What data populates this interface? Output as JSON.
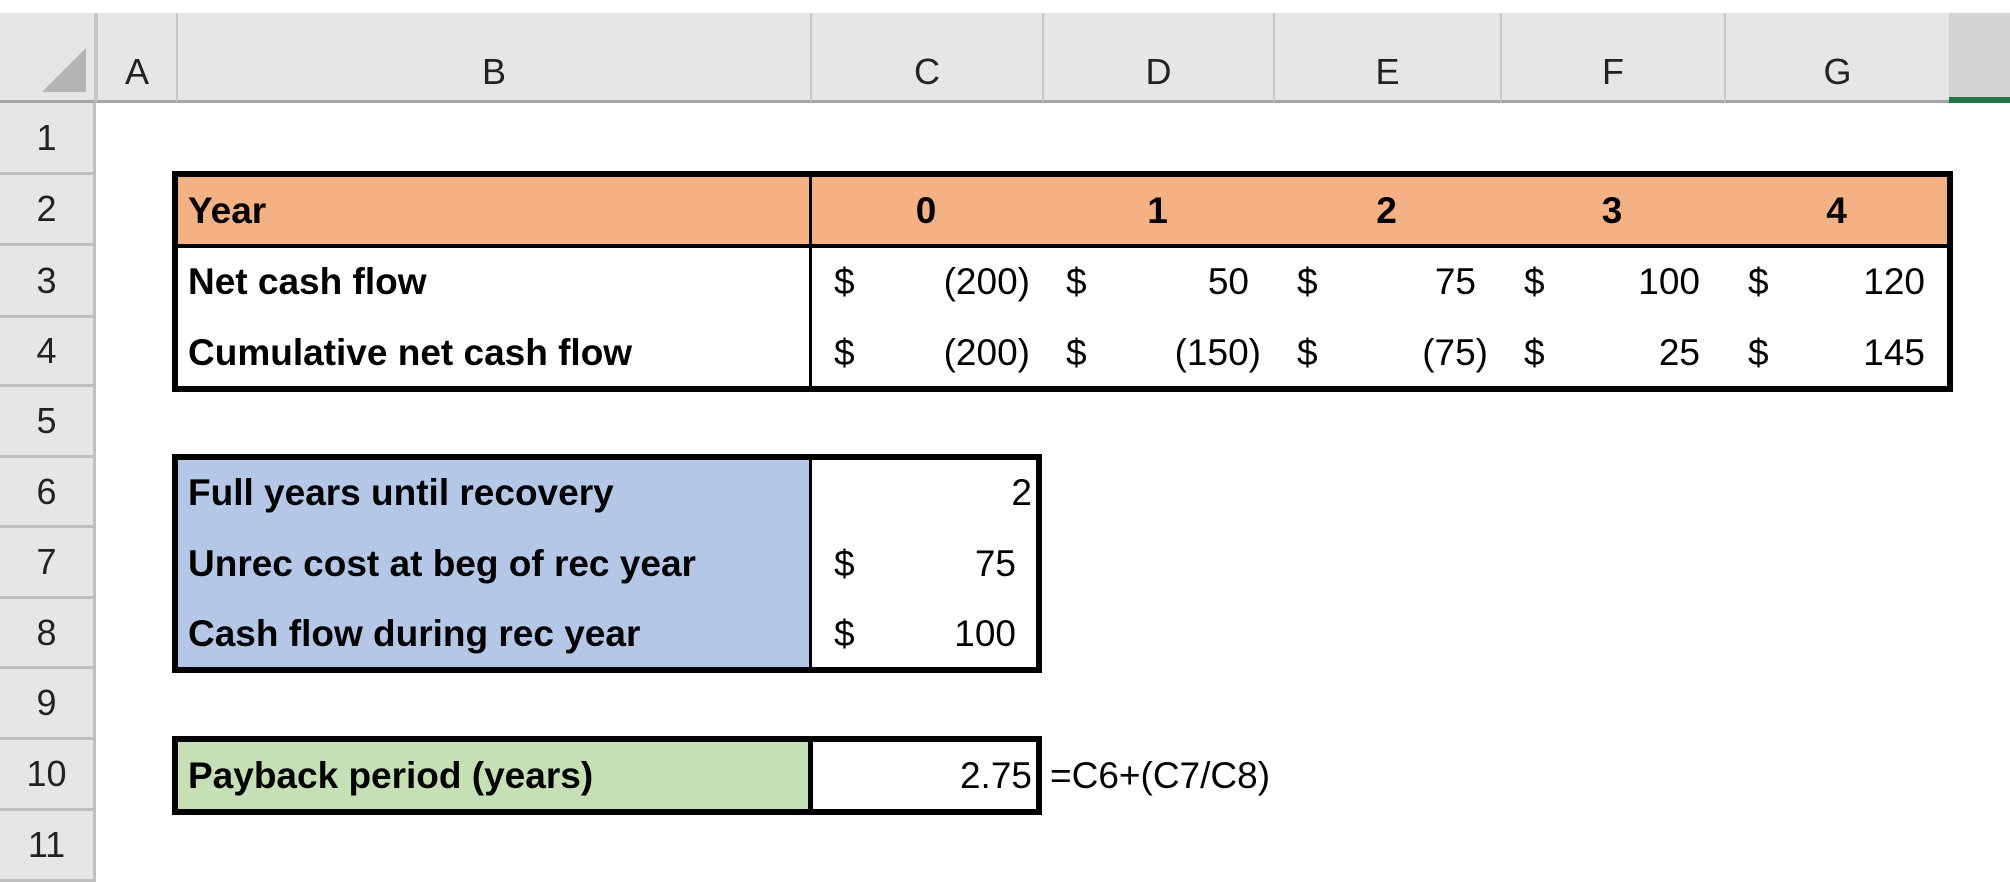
{
  "columns": [
    "A",
    "B",
    "C",
    "D",
    "E",
    "F",
    "G"
  ],
  "rows": [
    "1",
    "2",
    "3",
    "4",
    "5",
    "6",
    "7",
    "8",
    "9",
    "10",
    "11"
  ],
  "colors": {
    "year_header": "#f4b183",
    "inputs": "#b4c7e7",
    "result": "#c5e0b4",
    "header_bg": "#e6e6e6",
    "selection_accent": "#217346"
  },
  "cashflow_table": {
    "header_label": "Year",
    "years": [
      "0",
      "1",
      "2",
      "3",
      "4"
    ],
    "rows": [
      {
        "label": "Net cash flow",
        "currency": "$",
        "values": [
          "(200)",
          "50",
          "75",
          "100",
          "120"
        ]
      },
      {
        "label": "Cumulative net cash flow",
        "currency": "$",
        "values": [
          "(200)",
          "(150)",
          "(75)",
          "25",
          "145"
        ]
      }
    ]
  },
  "recovery_table": {
    "rows": [
      {
        "label": "Full years until recovery",
        "currency": "",
        "value": "2"
      },
      {
        "label": "Unrec cost at beg of rec year",
        "currency": "$",
        "value": "75"
      },
      {
        "label": "Cash flow during rec year",
        "currency": "$",
        "value": "100"
      }
    ]
  },
  "payback": {
    "label": "Payback period (years)",
    "value": "2.75",
    "formula": "=C6+(C7/C8)"
  }
}
